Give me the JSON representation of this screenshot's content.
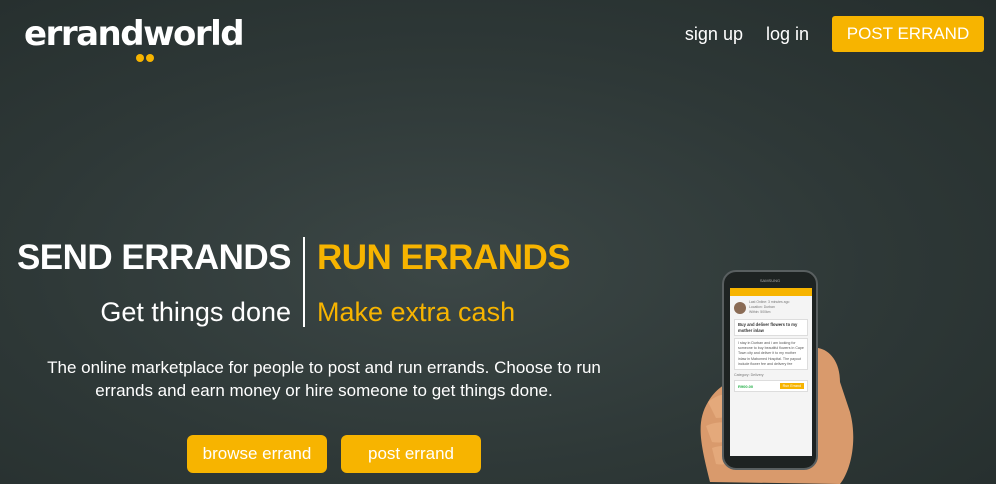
{
  "header": {
    "logo_text": "errandworld",
    "nav": {
      "signup": "sign up",
      "login": "log in",
      "post_errand": "POST ERRAND"
    }
  },
  "hero": {
    "left_title": "SEND ERRANDS",
    "right_title": "RUN ERRANDS",
    "left_subtitle": "Get things done",
    "right_subtitle": "Make extra cash",
    "description": "The online marketplace for people to post and run errands. Choose to run errands and earn money or hire someone to get things done.",
    "browse_button": "browse errand",
    "post_button": "post errand"
  },
  "phone": {
    "brand": "SAMSUNG",
    "meta": [
      "Last Online: 3 minutes ago",
      "Location: Durban",
      "Within: 500km"
    ],
    "errand_title": "Buy and deliver flowers to my mother inlaw",
    "errand_body": "I stay in Durban and i am looking for someone to buy beautiful flowers in Cape Town city and deliver it to my mother inlaw in Mabomed Hospital. The payout include flower fee and delivery fee",
    "category": "Category: Delivery",
    "price": "R900.00",
    "run_button": "Run Errand"
  },
  "colors": {
    "accent": "#f7b400",
    "background": "#2f3938"
  },
  "icons": {
    "logo_dots": "logo-dots-icon",
    "hand": "hand-holding-phone-icon"
  }
}
